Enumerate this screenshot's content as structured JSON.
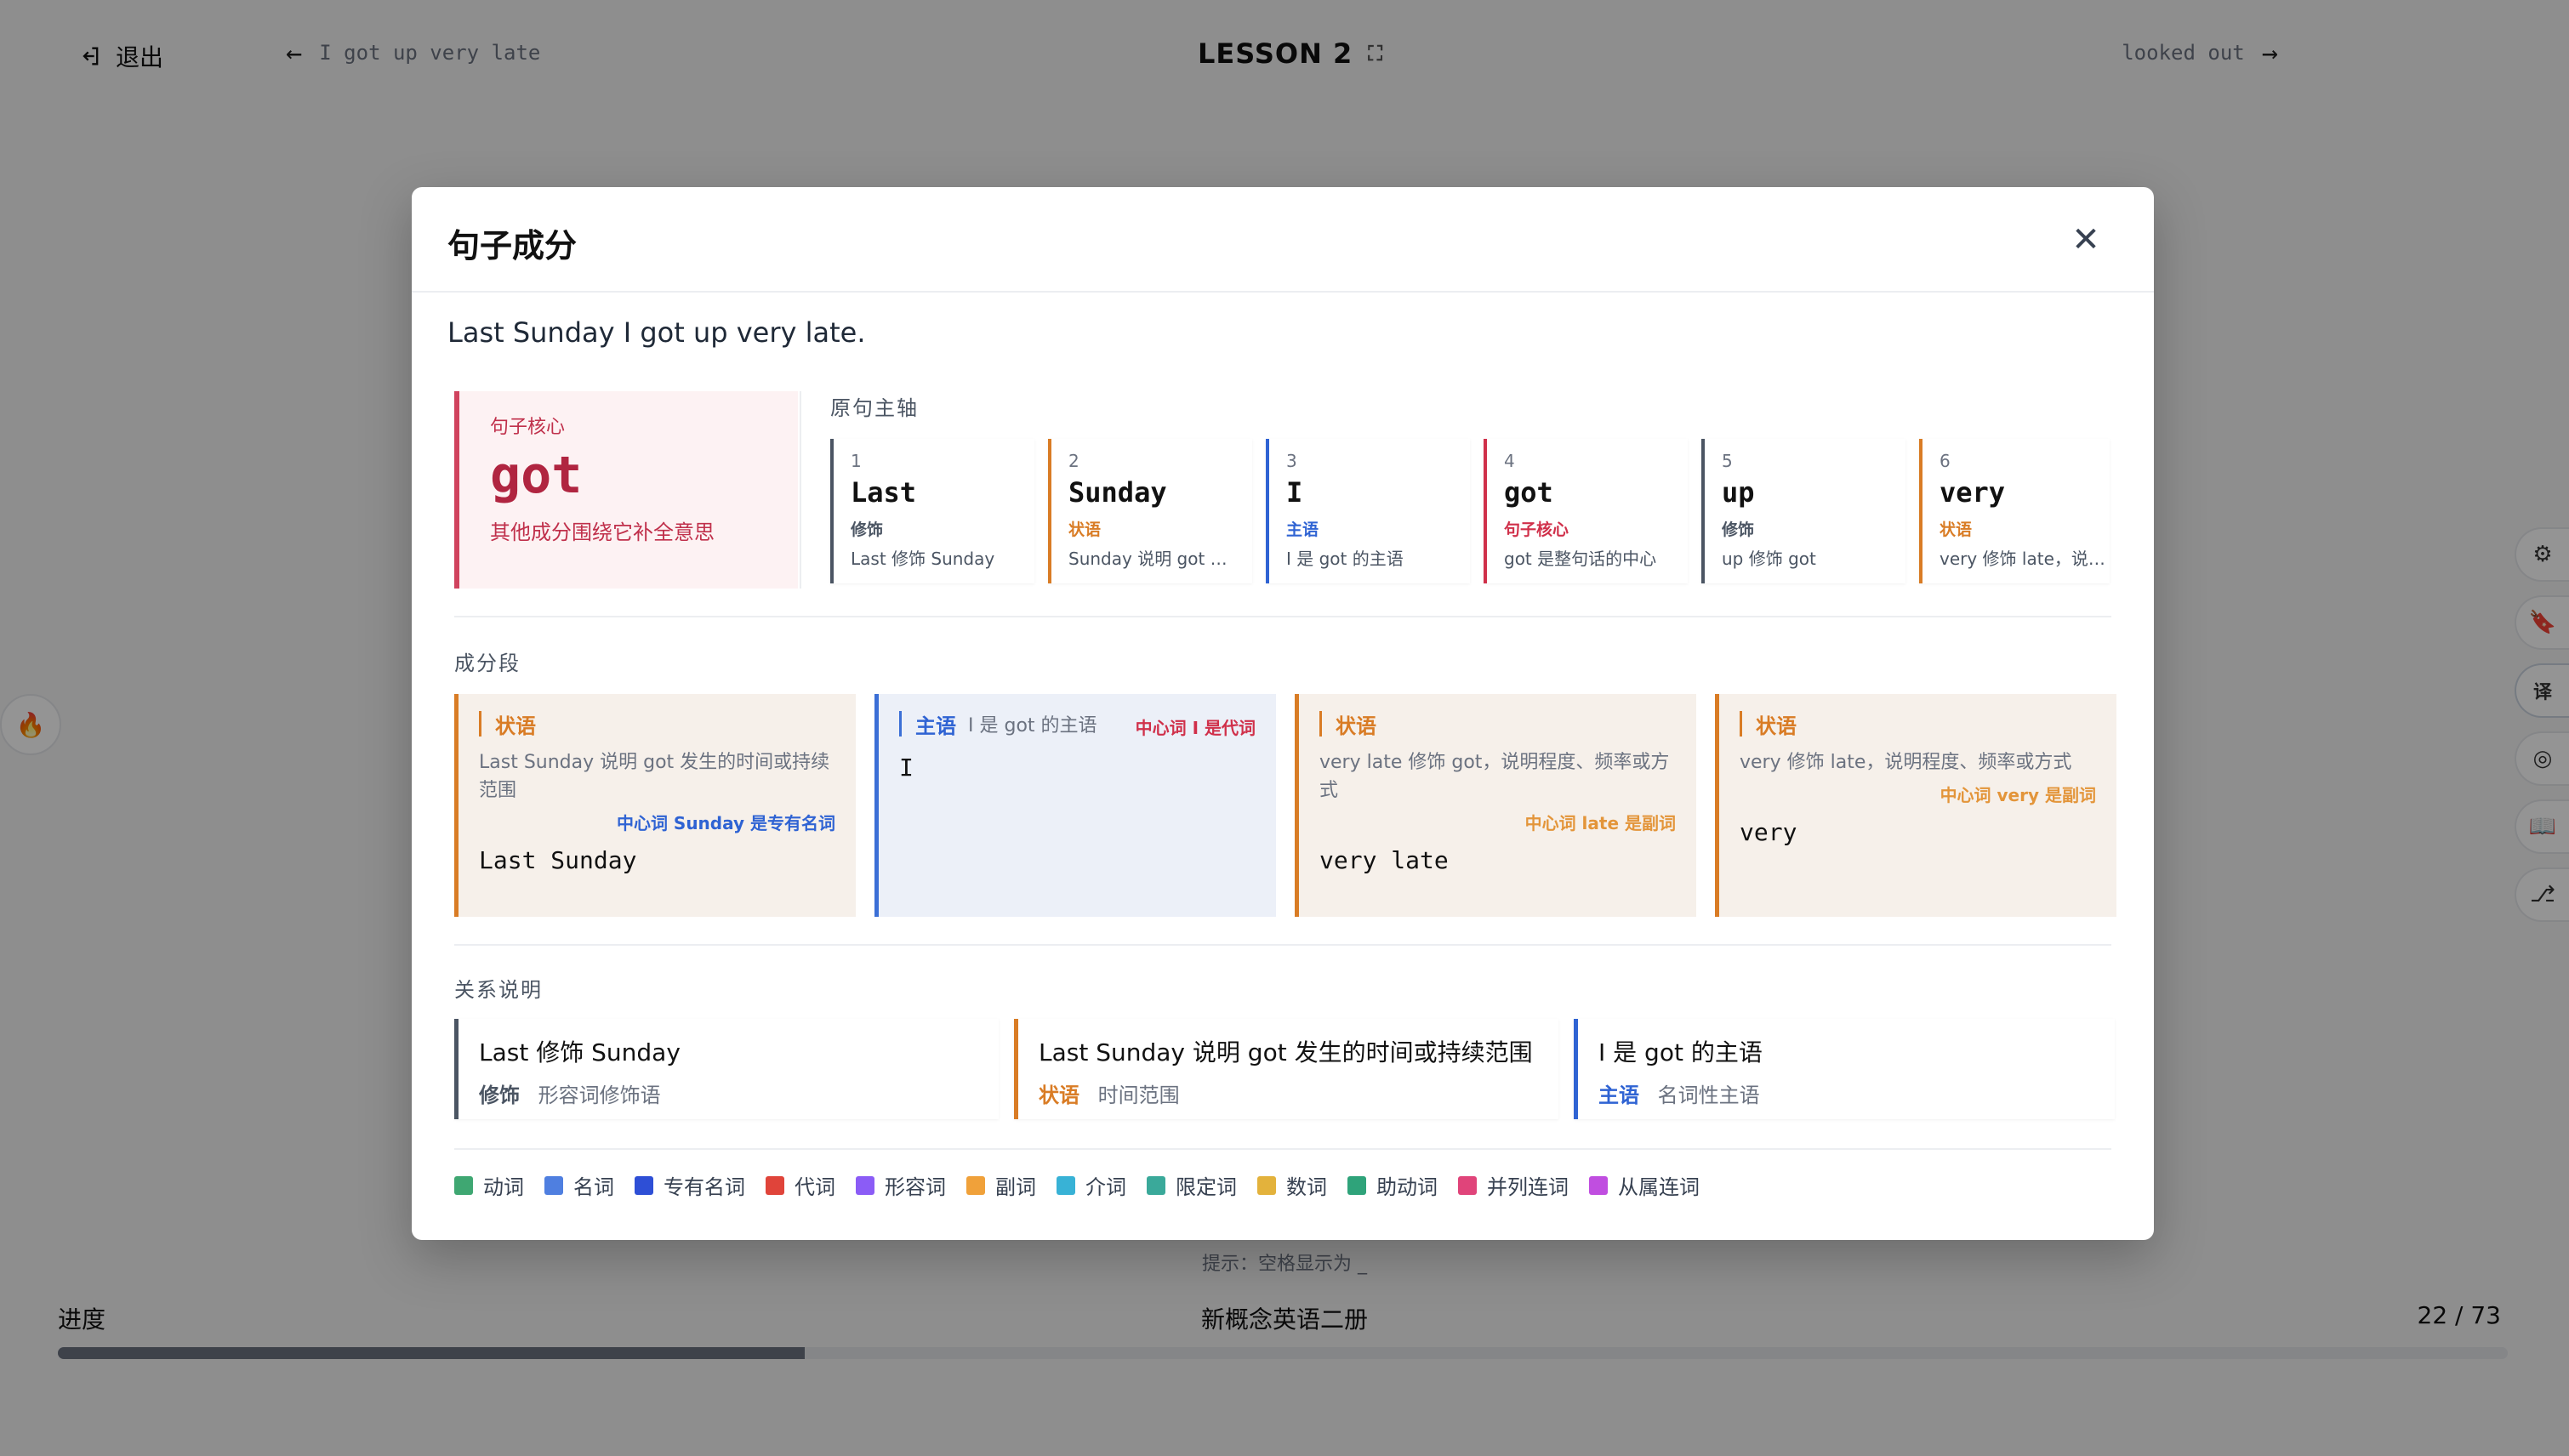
{
  "topbar": {
    "exit_label": "退出",
    "prev_sentence": "I got up very late",
    "lesson_title": "LESSON 2",
    "next_sentence": "looked out"
  },
  "footer": {
    "hint": "提示：空格显示为 _",
    "progress_label": "进度",
    "book_title": "新概念英语二册",
    "progress_count": "22 / 73",
    "progress_fraction": 0.305
  },
  "modal": {
    "title": "句子成分",
    "close_glyph": "✕",
    "sentence": "Last Sunday I got up very late.",
    "core": {
      "label": "句子核心",
      "word": "got",
      "desc": "其他成分围绕它补全意思",
      "color": "#d0435e"
    },
    "axis_title": "原句主轴",
    "tokens": [
      {
        "idx": "1",
        "word": "Last",
        "role": "修饰",
        "desc": "Last 修饰 Sunday",
        "color": "#4b5563"
      },
      {
        "idx": "2",
        "word": "Sunday",
        "role": "状语",
        "desc": "Sunday 说明 got …",
        "color": "#d97c25"
      },
      {
        "idx": "3",
        "word": "I",
        "role": "主语",
        "desc": "I 是 got 的主语",
        "color": "#2f63d3"
      },
      {
        "idx": "4",
        "word": "got",
        "role": "句子核心",
        "desc": "got 是整句话的中心",
        "color": "#d0304a"
      },
      {
        "idx": "5",
        "word": "up",
        "role": "修饰",
        "desc": "up 修饰 got",
        "color": "#4b5563"
      },
      {
        "idx": "6",
        "word": "very",
        "role": "状语",
        "desc": "very 修饰 late，说…",
        "color": "#d97c25"
      }
    ],
    "segments_title": "成分段",
    "segments": [
      {
        "role": "状语",
        "desc": "Last Sunday 说明 got 发生的时间或持续范围",
        "center": "中心词 Sunday 是专有名词",
        "center_color": "#2f63d3",
        "text": "Last Sunday"
      },
      {
        "role": "主语",
        "desc": "I 是 got 的主语",
        "center": "中心词 I 是代词",
        "text": "I"
      },
      {
        "role": "状语",
        "desc": "very late 修饰 got，说明程度、频率或方式",
        "center": "中心词 late 是副词",
        "center_color": "#e3953a",
        "text": "very late"
      },
      {
        "role": "状语",
        "desc": "very 修饰 late，说明程度、频率或方式",
        "center": "中心词 very 是副词",
        "center_color": "#e3953a",
        "text": "very"
      }
    ],
    "relations_title": "关系说明",
    "relations": [
      {
        "text": "Last 修饰 Sunday",
        "role": "修饰",
        "kind": "形容词修饰语",
        "color": "#4b5563"
      },
      {
        "text": "Last Sunday 说明 got 发生的时间或持续范围",
        "role": "状语",
        "kind": "时间范围",
        "color": "#d97c25"
      },
      {
        "text": "I 是 got 的主语",
        "role": "主语",
        "kind": "名词性主语",
        "color": "#2f63d3"
      }
    ],
    "legend": [
      {
        "label": "动词",
        "color": "#3fa772"
      },
      {
        "label": "名词",
        "color": "#4f7fe0"
      },
      {
        "label": "专有名词",
        "color": "#2e4fd6"
      },
      {
        "label": "代词",
        "color": "#e0443a"
      },
      {
        "label": "形容词",
        "color": "#8b5cf6"
      },
      {
        "label": "副词",
        "color": "#f0a13a"
      },
      {
        "label": "介词",
        "color": "#38b2d6"
      },
      {
        "label": "限定词",
        "color": "#3aa99a"
      },
      {
        "label": "数词",
        "color": "#e3b23c"
      },
      {
        "label": "助动词",
        "color": "#2fa37a"
      },
      {
        "label": "并列连词",
        "color": "#e0447a"
      },
      {
        "label": "从属连词",
        "color": "#c04ee0"
      }
    ]
  }
}
